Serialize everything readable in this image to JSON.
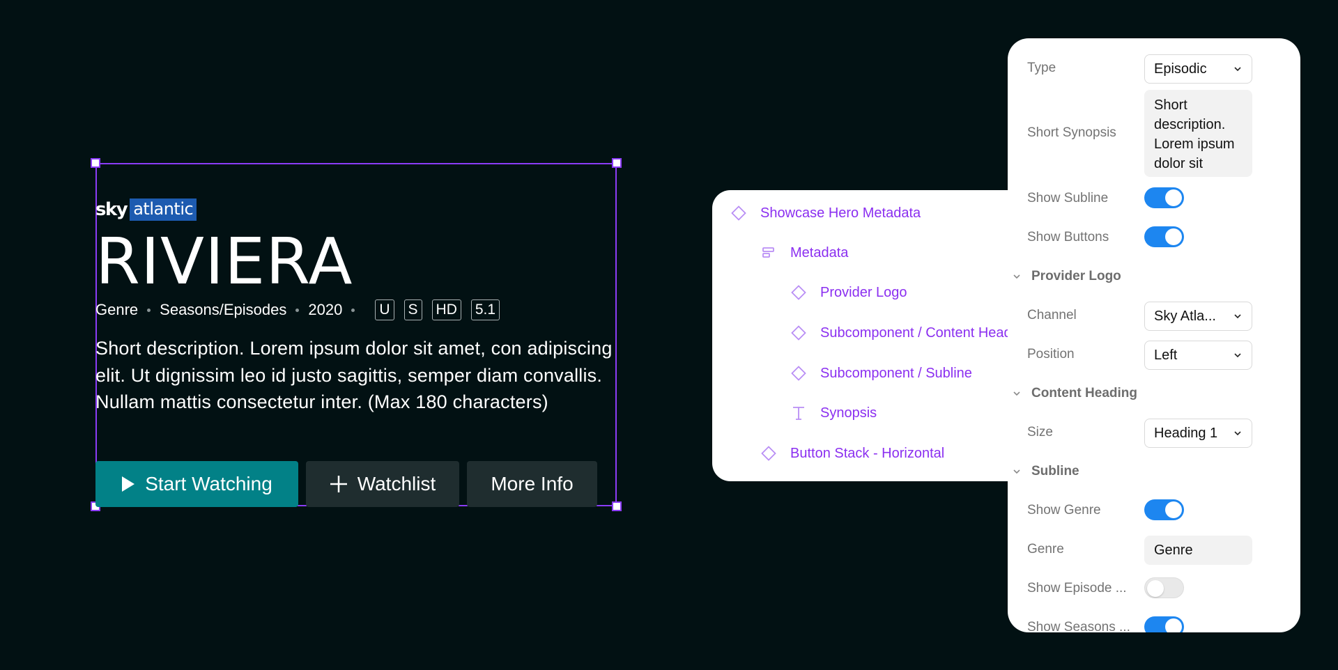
{
  "hero": {
    "logo": {
      "brand": "sky",
      "channel": "atlantic"
    },
    "title": "RIVIERA",
    "subline": {
      "genre": "Genre",
      "seasons": "Seasons/Episodes",
      "year": "2020"
    },
    "badges": [
      "U",
      "S",
      "HD",
      "5.1"
    ],
    "synopsis": "Short description. Lorem ipsum dolor sit amet, con adipiscing elit. Ut dignissim leo id justo sagittis, semper diam convallis. Nullam mattis consectetur inter. (Max 180 characters)",
    "buttons": {
      "start": "Start Watching",
      "watchlist": "Watchlist",
      "more": "More Info"
    },
    "colors": {
      "primary_button": "#028187",
      "secondary_button": "#1f2d2f",
      "selection": "#8b3cf7",
      "channel_bg": "#1d5bb0"
    }
  },
  "layers": {
    "items": [
      {
        "label": "Showcase Hero Metadata",
        "icon": "component-diamond-icon"
      },
      {
        "label": "Metadata",
        "icon": "auto-layout-icon"
      },
      {
        "label": "Provider Logo",
        "icon": "component-diamond-icon"
      },
      {
        "label": "Subcomponent / Content Heading",
        "icon": "component-diamond-icon"
      },
      {
        "label": "Subcomponent / Subline",
        "icon": "component-diamond-icon"
      },
      {
        "label": "Synopsis",
        "icon": "text-icon"
      },
      {
        "label": "Button Stack - Horizontal",
        "icon": "component-diamond-icon"
      }
    ],
    "color": "#8b2ff0"
  },
  "props": {
    "type": {
      "label": "Type",
      "value": "Episodic"
    },
    "short_synopsis": {
      "label": "Short Synopsis",
      "value": "Short description. Lorem ipsum dolor sit"
    },
    "show_subline": {
      "label": "Show Subline",
      "on": true
    },
    "show_buttons": {
      "label": "Show Buttons",
      "on": true
    },
    "provider_logo": {
      "section": "Provider Logo"
    },
    "channel": {
      "label": "Channel",
      "value": "Sky Atla..."
    },
    "position": {
      "label": "Position",
      "value": "Left"
    },
    "content_heading": {
      "section": "Content Heading"
    },
    "size": {
      "label": "Size",
      "value": "Heading 1"
    },
    "subline": {
      "section": "Subline"
    },
    "show_genre": {
      "label": "Show Genre",
      "on": true
    },
    "genre": {
      "label": "Genre",
      "value": "Genre"
    },
    "show_episode": {
      "label": "Show Episode ...",
      "on": false
    },
    "show_seasons": {
      "label": "Show Seasons ...",
      "on": true
    },
    "toggle_on_color": "#1d86f0"
  }
}
